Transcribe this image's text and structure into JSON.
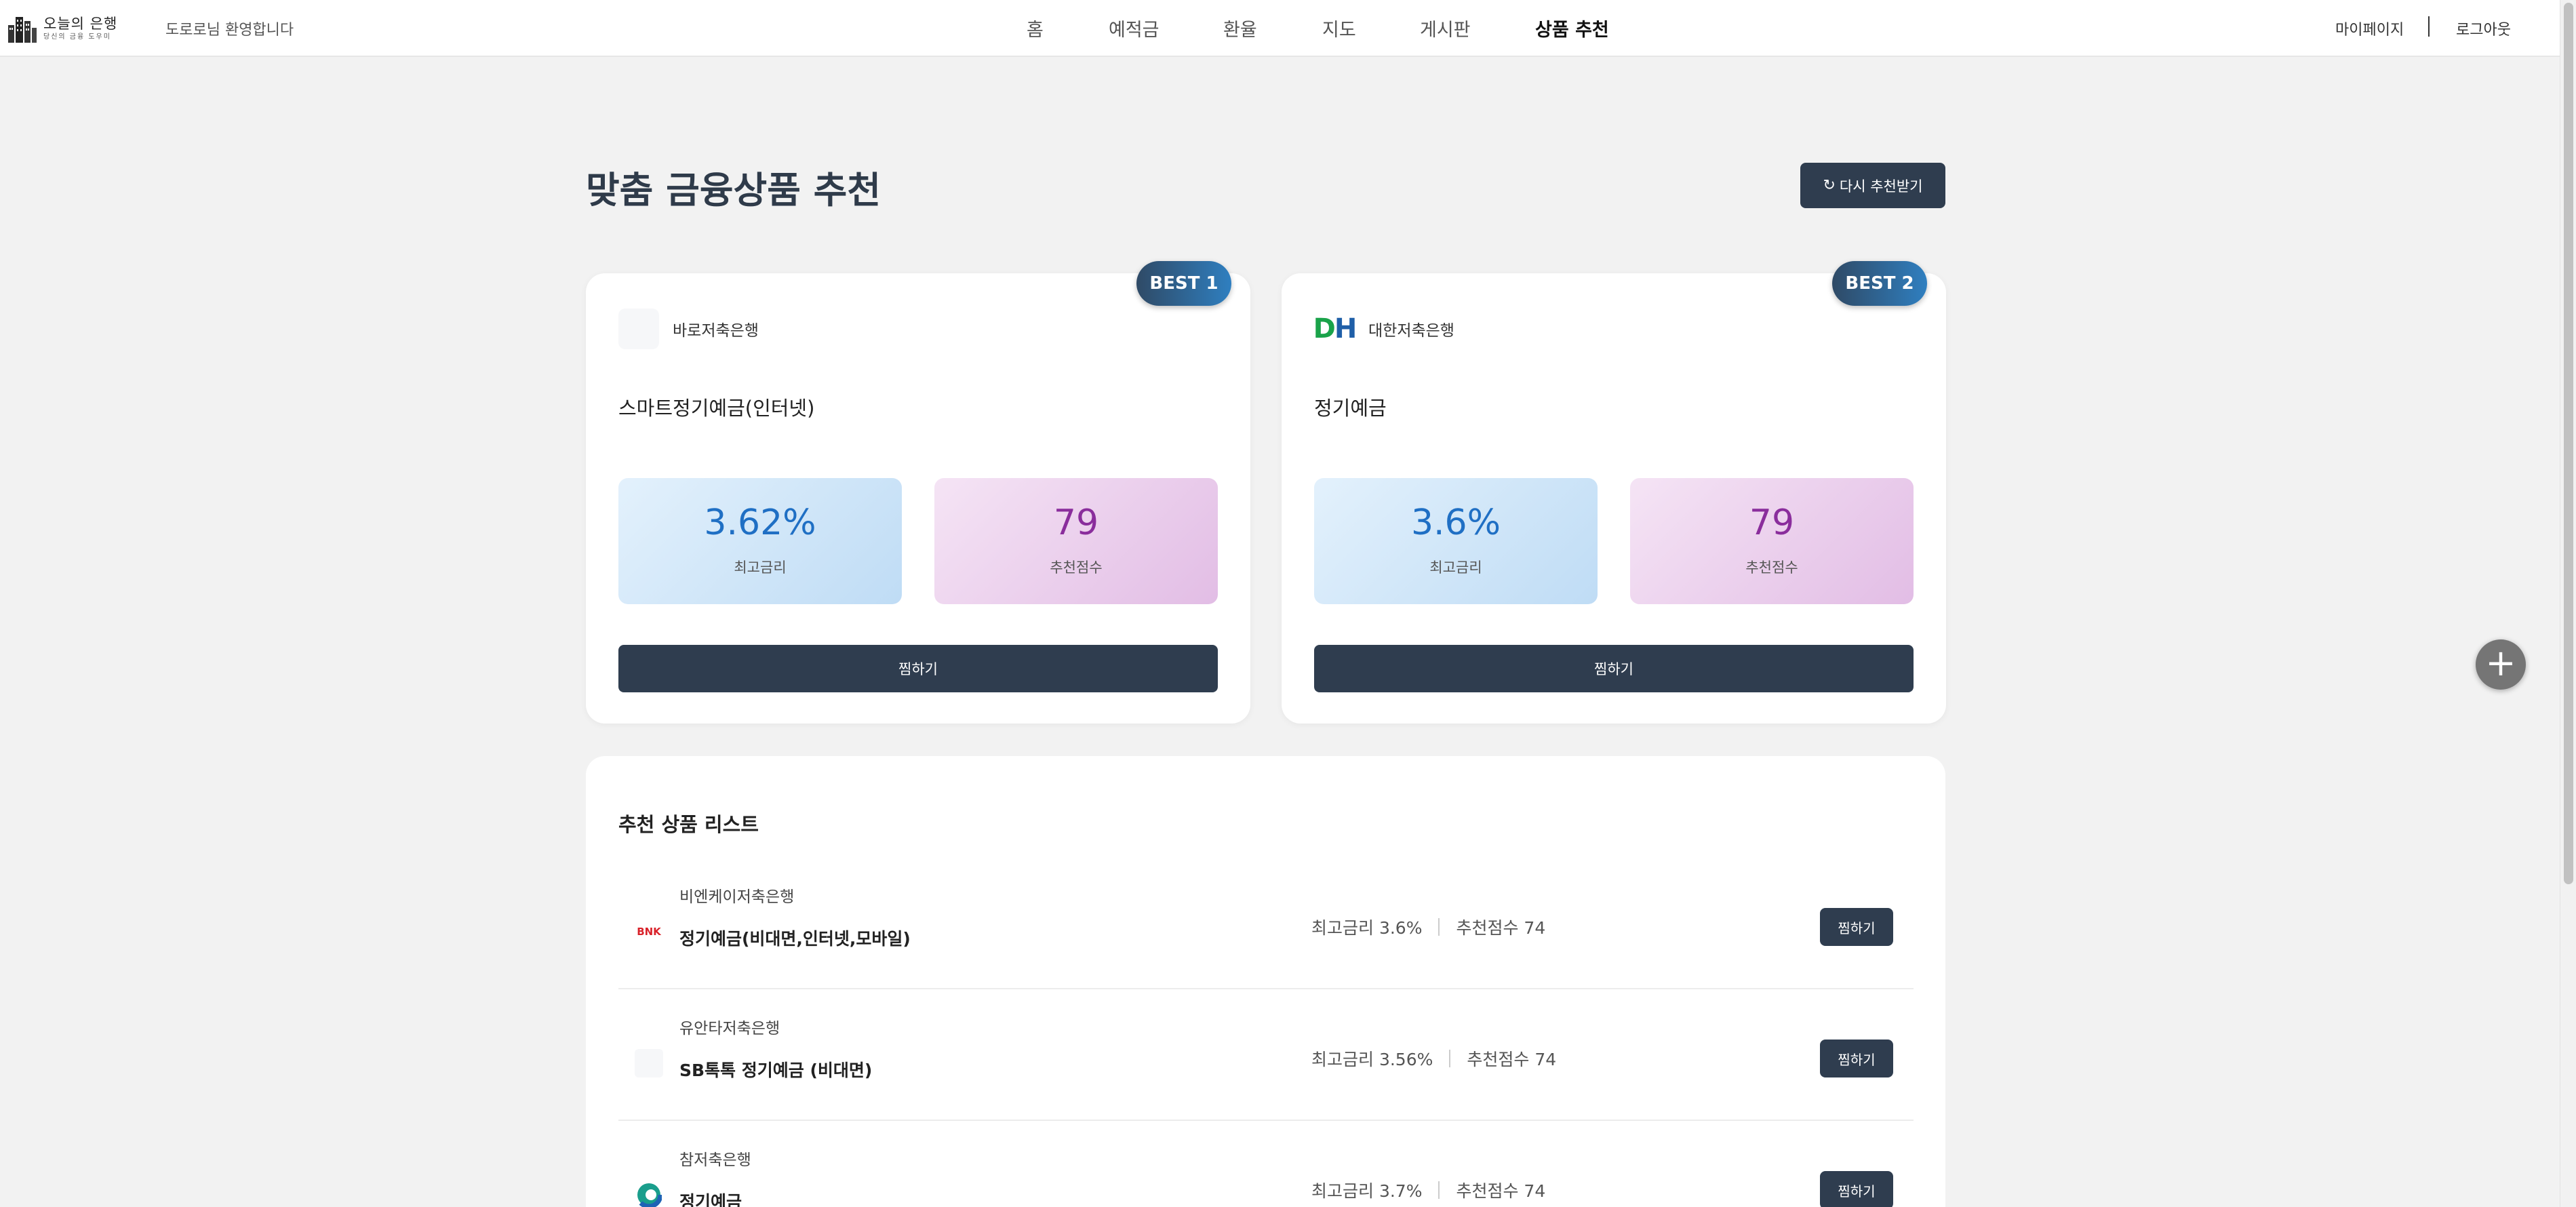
{
  "header": {
    "logo_main": "오늘의 은행",
    "logo_sub": "당신의 금융 도우미",
    "welcome": "도로로님 환영합니다",
    "nav": [
      "홈",
      "예적금",
      "환율",
      "지도",
      "게시판",
      "상품 추천"
    ],
    "active_nav": "상품 추천",
    "mypage": "마이페이지",
    "logout": "로그아웃"
  },
  "main": {
    "title": "맞춤 금융상품 추천",
    "refresh_label": "다시 추천받기",
    "refresh_icon": "refresh-icon"
  },
  "top_cards": [
    {
      "badge": "BEST 1",
      "bank": "바로저축은행",
      "product": "스마트정기예금(인터넷)",
      "rate": "3.62%",
      "rate_label": "최고금리",
      "score": "79",
      "score_label": "추천점수",
      "button": "찜하기"
    },
    {
      "badge": "BEST 2",
      "bank": "대한저축은행",
      "bank_logo_text": "DH",
      "product": "정기예금",
      "rate": "3.6%",
      "rate_label": "최고금리",
      "score": "79",
      "score_label": "추천점수",
      "button": "찜하기"
    }
  ],
  "list": {
    "title": "추천 상품 리스트",
    "items": [
      {
        "bank": "비엔케이저축은행",
        "logo_text": "BNK",
        "product": "정기예금(비대면,인터넷,모바일)",
        "rate_text": "최고금리 3.6%",
        "score_text": "추천점수 74",
        "button": "찜하기"
      },
      {
        "bank": "유안타저축은행",
        "logo_text": "",
        "product": "SB톡톡 정기예금 (비대면)",
        "rate_text": "최고금리 3.56%",
        "score_text": "추천점수 74",
        "button": "찜하기"
      },
      {
        "bank": "참저축은행",
        "logo_text": "",
        "product": "정기예금",
        "rate_text": "최고금리 3.7%",
        "score_text": "추천점수 74",
        "button": "찜하기"
      }
    ]
  },
  "colors": {
    "primary_button": "#2f3d4f",
    "rate_text": "#1f6fc4",
    "score_text": "#8a2d9c",
    "badge_gradient_start": "#2f4a66",
    "badge_gradient_end": "#2f7fc0"
  },
  "fab_icon": "plus-icon"
}
